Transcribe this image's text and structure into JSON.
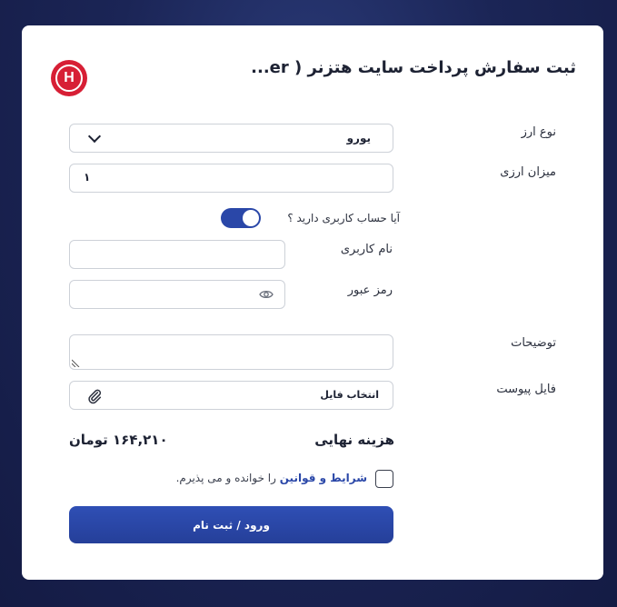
{
  "form": {
    "title": "ثبت سفارش پرداخت سایت هتزنر ( er...",
    "logo": {
      "letter": "H",
      "color": "#d71f35"
    },
    "currency_type": {
      "label": "نوع ارز",
      "value": "یورو"
    },
    "amount": {
      "label": "میزان ارزی",
      "value": "۱"
    },
    "account_question": {
      "label": "آیا حساب کاربری دارید ؟",
      "toggle_on": true
    },
    "username": {
      "label": "نام کاربری",
      "value": ""
    },
    "password": {
      "label": "رمز عبور",
      "value": ""
    },
    "description": {
      "label": "توضیحات",
      "value": ""
    },
    "attachment": {
      "label": "فایل پیوست",
      "button_label": "انتخاب فایل"
    },
    "total": {
      "label": "هزینه نهایی",
      "value": "۱۶۴,۲۱۰ تومان"
    },
    "terms": {
      "link_text": "شرایط و قوانین",
      "rest_text": " را خوانده و می پذیرم."
    },
    "submit_label": "ورود / ثبت نام"
  },
  "colors": {
    "accent": "#2a47a8",
    "logo": "#d71f35",
    "background": "#1b2556"
  }
}
